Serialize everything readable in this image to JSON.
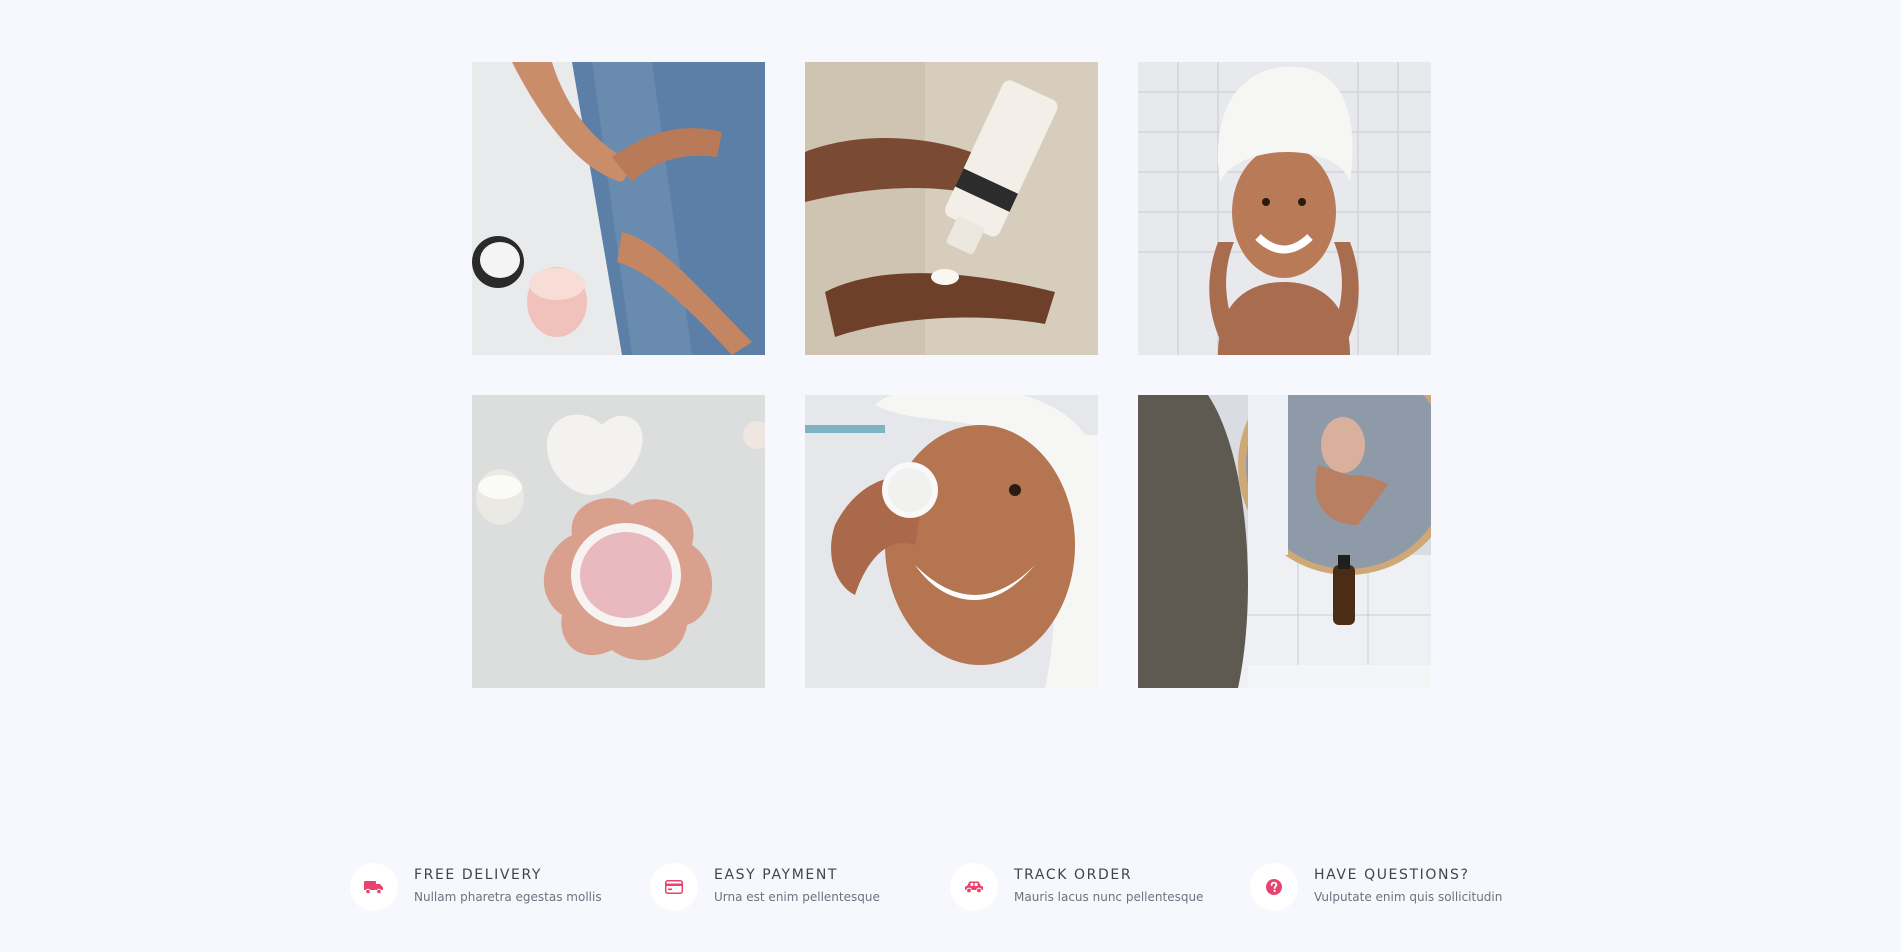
{
  "gallery": {
    "images": [
      {
        "name": "gallery-image-hand-cream",
        "icon": "photo-icon"
      },
      {
        "name": "gallery-image-lotion-tube",
        "icon": "photo-icon"
      },
      {
        "name": "gallery-image-towel-smile",
        "icon": "photo-icon"
      },
      {
        "name": "gallery-image-cream-dish",
        "icon": "photo-icon"
      },
      {
        "name": "gallery-image-cotton-pad",
        "icon": "photo-icon"
      },
      {
        "name": "gallery-image-mirror-mask",
        "icon": "photo-icon"
      }
    ]
  },
  "features": [
    {
      "icon": "truck-icon",
      "title": "FREE DELIVERY",
      "subtitle": "Nullam pharetra egestas mollis"
    },
    {
      "icon": "credit-card-icon",
      "title": "EASY PAYMENT",
      "subtitle": "Urna est enim pellentesque"
    },
    {
      "icon": "car-icon",
      "title": "TRACK ORDER",
      "subtitle": "Mauris lacus nunc pellentesque"
    },
    {
      "icon": "question-circle-icon",
      "title": "HAVE QUESTIONS?",
      "subtitle": "Vulputate enim quis sollicitudin"
    }
  ],
  "colors": {
    "accent": "#e8436e",
    "background": "#f7f8fd",
    "title_text": "#3f4550",
    "sub_text": "#6b7280"
  }
}
